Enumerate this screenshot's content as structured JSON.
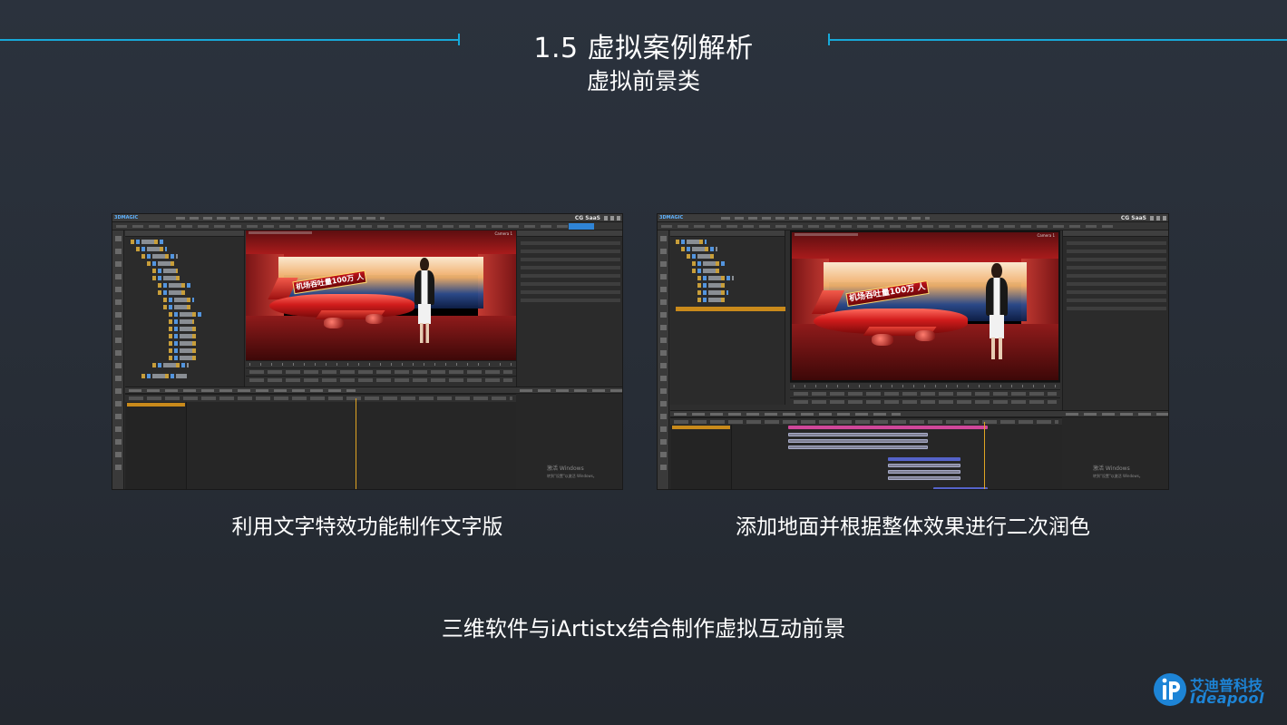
{
  "header": {
    "title": "1.5  虚拟案例解析",
    "subtitle": "虚拟前景类"
  },
  "screenshots": [
    {
      "app_brand": "3DMAGIC",
      "product_mark": "CG SaaS",
      "camera_label": "Camera 1",
      "banner_text": "机场吞吐量100万 人",
      "watermark_title": "激活 Windows",
      "watermark_sub": "转到\"设置\"以激活 Windows。"
    },
    {
      "app_brand": "3DMAGIC",
      "product_mark": "CG SaaS",
      "camera_label": "Camera 1",
      "banner_text": "机场吞吐量100万 人",
      "watermark_title": "激活 Windows",
      "watermark_sub": "转到\"设置\"以激活 Windows。"
    }
  ],
  "captions": {
    "left": "利用文字特效功能制作文字版",
    "right": "添加地面并根据整体效果进行二次润色"
  },
  "footer": {
    "summary": "三维软件与iArtistx结合制作虚拟互动前景"
  },
  "logo": {
    "cn": "艾迪普科技",
    "en": "Ideapool",
    "color": "#1d84d6"
  },
  "colors": {
    "accent_line": "#17a8d8",
    "background": "#2b323d"
  }
}
